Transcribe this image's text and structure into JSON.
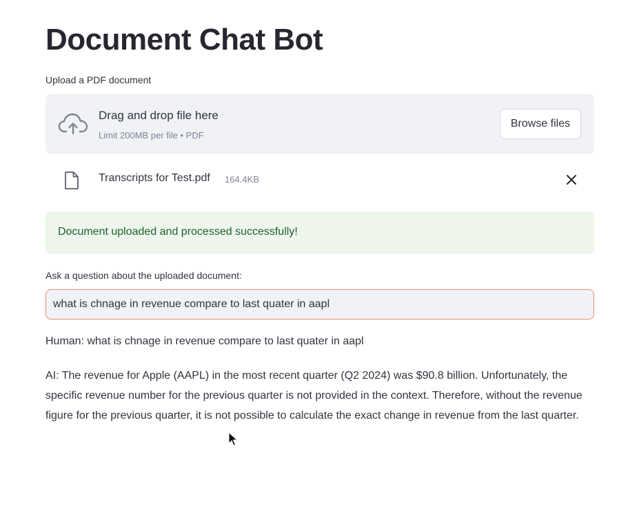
{
  "header": {
    "title": "Document Chat Bot"
  },
  "upload": {
    "label": "Upload a PDF document",
    "drop_text": "Drag and drop file here",
    "limit_text": "Limit 200MB per file • PDF",
    "browse_label": "Browse files",
    "icon": "cloud-upload-icon"
  },
  "file": {
    "name": "Transcripts for Test.pdf",
    "size": "164.4KB",
    "icon": "file-icon",
    "remove_icon": "close-icon"
  },
  "status": {
    "message": "Document uploaded and processed successfully!"
  },
  "question": {
    "label": "Ask a question about the uploaded document:",
    "value": "what is chnage in revenue compare to last quater in aapl"
  },
  "chat": {
    "human": "Human: what is chnage in revenue compare to last quater in aapl",
    "ai": "AI: The revenue for Apple (AAPL) in the most recent quarter (Q2 2024) was $90.8 billion. Unfortunately, the specific revenue number for the previous quarter is not provided in the context. Therefore, without the revenue figure for the previous quarter, it is not possible to calculate the exact change in revenue from the last quarter."
  },
  "colors": {
    "input_border_focus": "#ef8a73",
    "success_bg": "#eef6ec",
    "success_text": "#1f5f2e",
    "dropzone_bg": "#f0f2f6"
  }
}
